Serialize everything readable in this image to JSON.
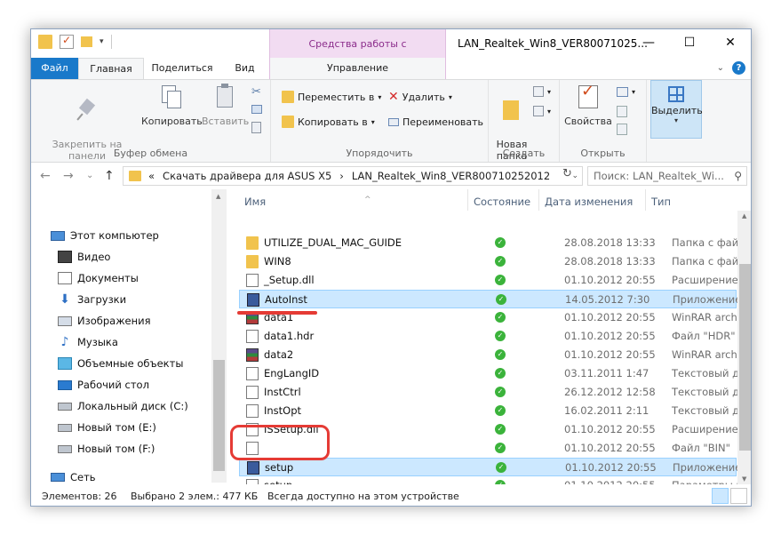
{
  "window": {
    "title": "LAN_Realtek_Win8_VER80071025...",
    "context_tab_header": "Средства работы с приложениями",
    "controls": [
      "—",
      "☐",
      "✕"
    ]
  },
  "tabs": {
    "file": "Файл",
    "home": "Главная",
    "share": "Поделиться",
    "view": "Вид",
    "manage": "Управление"
  },
  "ribbon": {
    "clipboard": {
      "pin": "Закрепить на панели\nбыстрого доступа",
      "copy": "Копировать",
      "paste": "Вставить",
      "label": "Буфер обмена"
    },
    "organize": {
      "move_to": "Переместить в",
      "copy_to": "Копировать в",
      "delete": "Удалить",
      "rename": "Переименовать",
      "label": "Упорядочить"
    },
    "new": {
      "new_folder": "Новая\nпапка",
      "label": "Создать"
    },
    "open": {
      "properties": "Свойства",
      "label": "Открыть"
    },
    "select": {
      "select": "Выделить"
    }
  },
  "address": {
    "prefix": "«",
    "crumbs": [
      "Скачать драйвера для ASUS X5",
      "›",
      "LAN_Realtek_Win8_VER800710252012"
    ],
    "search_placeholder": "Поиск: LAN_Realtek_Wi..."
  },
  "nav_pane": {
    "items": [
      {
        "label": "Этот компьютер",
        "icon": "computer-icon"
      },
      {
        "label": "Видео",
        "icon": "video-icon"
      },
      {
        "label": "Документы",
        "icon": "documents-icon"
      },
      {
        "label": "Загрузки",
        "icon": "downloads-icon"
      },
      {
        "label": "Изображения",
        "icon": "images-icon"
      },
      {
        "label": "Музыка",
        "icon": "music-icon"
      },
      {
        "label": "Объемные объекты",
        "icon": "3d-objects-icon"
      },
      {
        "label": "Рабочий стол",
        "icon": "desktop-icon"
      },
      {
        "label": "Локальный диск (C:)",
        "icon": "drive-icon"
      },
      {
        "label": "Новый том (E:)",
        "icon": "drive-icon"
      },
      {
        "label": "Новый том (F:)",
        "icon": "drive-icon"
      },
      {
        "label": "Сеть",
        "icon": "network-icon"
      }
    ]
  },
  "columns": {
    "name": "Имя",
    "status": "Состояние",
    "date": "Дата изменения",
    "type": "Тип"
  },
  "files": [
    {
      "name": "UTILIZE_DUAL_MAC_GUIDE",
      "date": "28.08.2018 13:33",
      "type": "Папка с файлами",
      "kind": "folder"
    },
    {
      "name": "WIN8",
      "date": "28.08.2018 13:33",
      "type": "Папка с файлами",
      "kind": "folder"
    },
    {
      "name": "_Setup.dll",
      "date": "01.10.2012 20:55",
      "type": "Расширение при",
      "kind": "doc"
    },
    {
      "name": "AutoInst",
      "date": "14.05.2012 7:30",
      "type": "Приложение",
      "kind": "app",
      "selected": true
    },
    {
      "name": "data1",
      "date": "01.10.2012 20:55",
      "type": "WinRAR archive",
      "kind": "rar"
    },
    {
      "name": "data1.hdr",
      "date": "01.10.2012 20:55",
      "type": "Файл \"HDR\"",
      "kind": "doc"
    },
    {
      "name": "data2",
      "date": "01.10.2012 20:55",
      "type": "WinRAR archive",
      "kind": "rar"
    },
    {
      "name": "EngLangID",
      "date": "03.11.2011 1:47",
      "type": "Текстовый докум",
      "kind": "doc"
    },
    {
      "name": "InstCtrl",
      "date": "26.12.2012 12:58",
      "type": "Текстовый докум",
      "kind": "doc"
    },
    {
      "name": "InstOpt",
      "date": "16.02.2011 2:11",
      "type": "Текстовый докум",
      "kind": "doc"
    },
    {
      "name": "ISSetup.dll",
      "date": "01.10.2012 20:55",
      "type": "Расширение при",
      "kind": "doc"
    },
    {
      "name": "",
      "date": "01.10.2012 20:55",
      "type": "Файл \"BIN\"",
      "kind": "doc"
    },
    {
      "name": "setup",
      "date": "01.10.2012 20:55",
      "type": "Приложение",
      "kind": "app",
      "selected": true
    },
    {
      "name": "setup",
      "date": "01.10.2012 20:55",
      "type": "Параметры конф",
      "kind": "doc"
    }
  ],
  "status": {
    "count": "Элементов: 26",
    "selected": "Выбрано 2 элем.: 477 КБ",
    "availability": "Всегда доступно на этом устройстве"
  },
  "colors": {
    "accent": "#1979ca",
    "selection": "#cce8ff",
    "annotation": "#e53b35"
  }
}
